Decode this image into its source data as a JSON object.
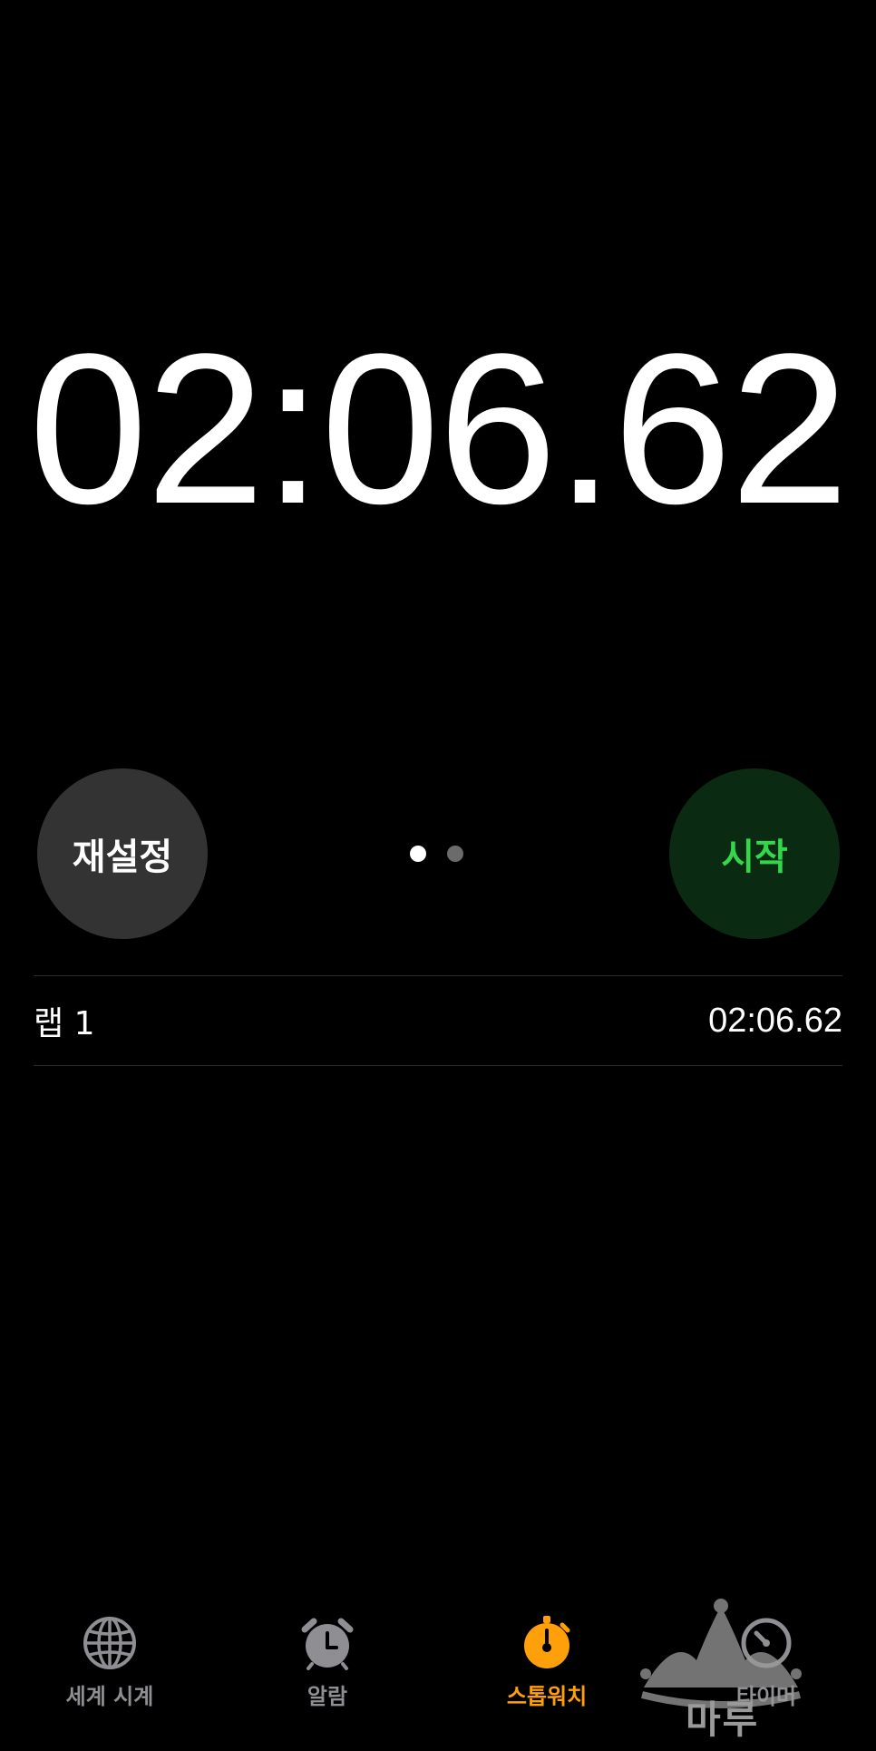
{
  "stopwatch": {
    "time": "02:06.62"
  },
  "controls": {
    "reset_label": "재설정",
    "start_label": "시작",
    "page_count": 2,
    "active_page": 1
  },
  "laps": [
    {
      "label": "랩 1",
      "time": "02:06.62"
    }
  ],
  "tabbar": {
    "tabs": [
      {
        "label": "세계 시계",
        "icon": "globe-icon",
        "active": false
      },
      {
        "label": "알람",
        "icon": "alarm-clock-icon",
        "active": false
      },
      {
        "label": "스톱워치",
        "icon": "stopwatch-icon",
        "active": true
      },
      {
        "label": "타이머",
        "icon": "timer-icon",
        "active": false
      }
    ]
  },
  "watermark": {
    "text": "마루",
    "icon": "crown-icon"
  },
  "colors": {
    "background": "#000000",
    "reset_button": "#333333",
    "start_button_bg": "#0a2a12",
    "start_button_text": "#32d74b",
    "active_tab": "#ff9f0a",
    "inactive_tab": "#8e8e93"
  }
}
